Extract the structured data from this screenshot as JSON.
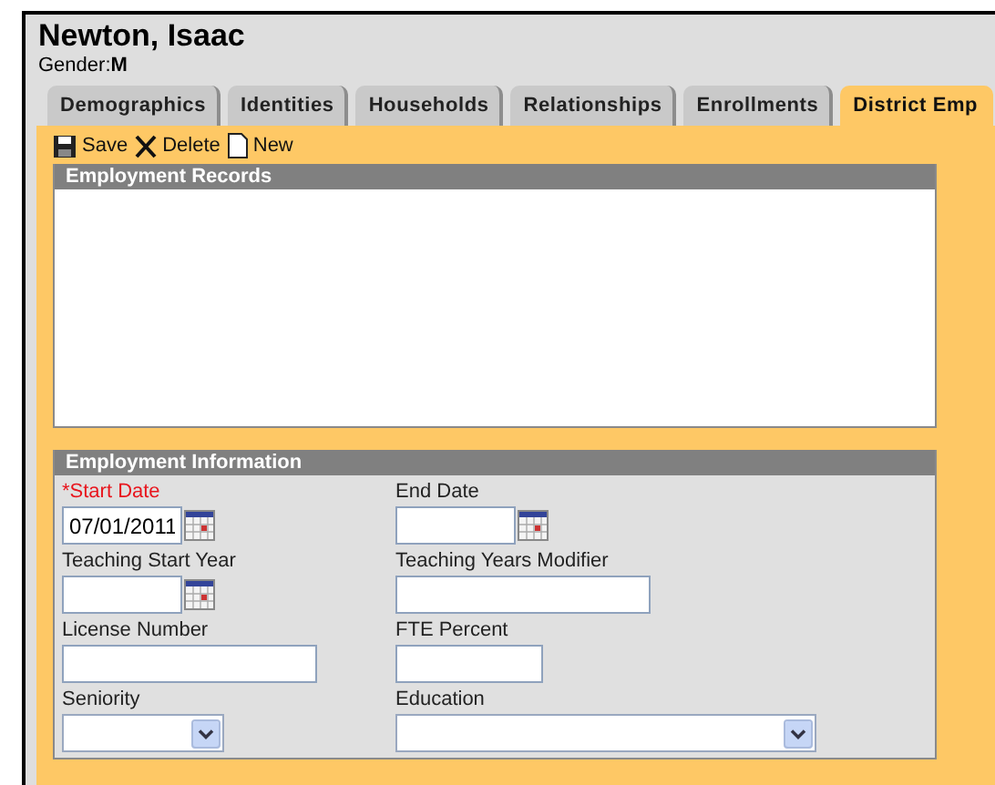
{
  "person": {
    "name": "Newton, Isaac",
    "gender_label": "Gender:",
    "gender": "M"
  },
  "tabs": [
    {
      "label": "Demographics",
      "selected": false
    },
    {
      "label": "Identities",
      "selected": false
    },
    {
      "label": "Households",
      "selected": false
    },
    {
      "label": "Relationships",
      "selected": false
    },
    {
      "label": "Enrollments",
      "selected": false
    },
    {
      "label": "District Emp",
      "selected": true
    }
  ],
  "toolbar": [
    {
      "kind": "save",
      "label": "Save"
    },
    {
      "kind": "delete",
      "label": "Delete"
    },
    {
      "kind": "new",
      "label": "New"
    }
  ],
  "records_panel": {
    "title": "Employment Records"
  },
  "info_panel": {
    "title": "Employment Information",
    "fields": [
      {
        "kind": "date",
        "label": "*Start Date",
        "required": true,
        "value": "07/01/2011"
      },
      {
        "kind": "date",
        "label": "End Date",
        "required": false
      },
      {
        "kind": "date",
        "label": "Teaching Start Year",
        "required": false
      },
      {
        "kind": "text",
        "label": "Teaching Years Modifier",
        "required": false
      },
      {
        "kind": "text",
        "label": "License Number",
        "required": false
      },
      {
        "kind": "text",
        "label": "FTE Percent",
        "required": false
      },
      {
        "kind": "select",
        "label": "Seniority",
        "required": false
      },
      {
        "kind": "select",
        "label": "Education",
        "required": false
      }
    ]
  }
}
